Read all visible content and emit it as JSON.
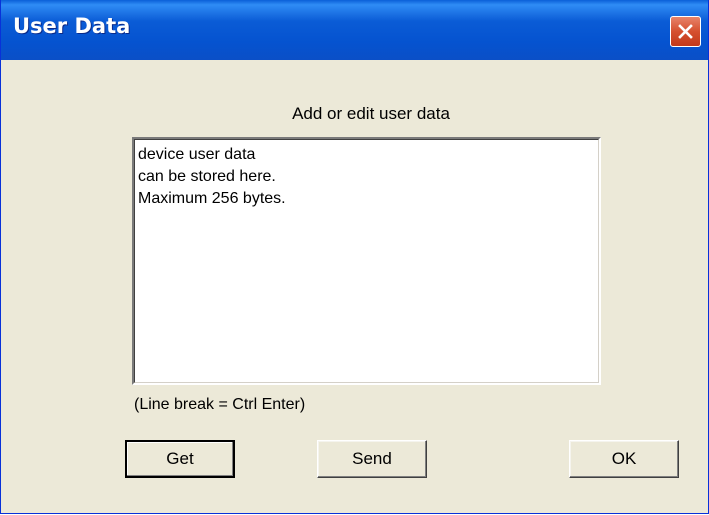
{
  "window": {
    "title": "User Data",
    "close_icon": "close-icon"
  },
  "dialog": {
    "heading": "Add or edit user data",
    "user_data_text": "device user data\ncan be stored here.\nMaximum 256 bytes.",
    "hint": "(Line break = Ctrl Enter)"
  },
  "buttons": {
    "get_label": "Get",
    "send_label": "Send",
    "ok_label": "OK",
    "default": "Get"
  },
  "colors": {
    "titlebar_blue": "#0553d0",
    "dialog_face": "#ece9d8",
    "close_red": "#d5502f"
  }
}
